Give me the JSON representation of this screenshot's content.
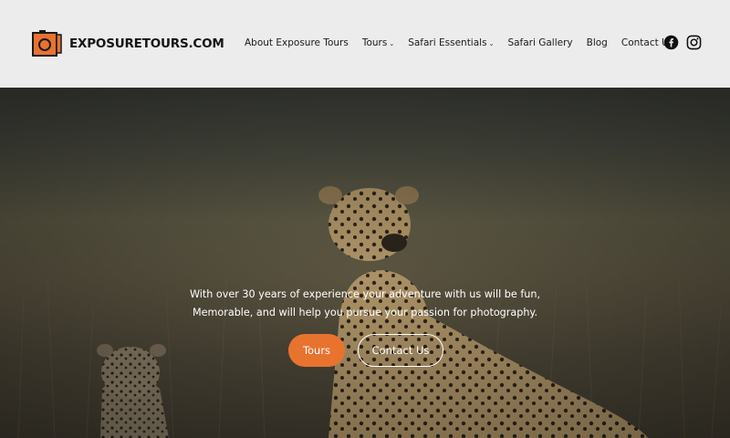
{
  "site": {
    "logo_text": "EXPOSURETOURS.COM",
    "accent_color": "#e8732f"
  },
  "nav": {
    "items": [
      {
        "label": "About Exposure Tours",
        "has_dropdown": false
      },
      {
        "label": "Tours",
        "has_dropdown": true
      },
      {
        "label": "Safari Essentials",
        "has_dropdown": true
      },
      {
        "label": "Safari Gallery",
        "has_dropdown": false
      },
      {
        "label": "Blog",
        "has_dropdown": false
      },
      {
        "label": "Contact Us",
        "has_dropdown": false
      }
    ],
    "social": [
      "facebook-icon",
      "instagram-icon"
    ]
  },
  "hero": {
    "line1": "With over 30 years of experience your adventure with us will be fun,",
    "line2": "Memorable, and will help you pursue your passion for photography.",
    "primary_button": "Tours",
    "secondary_button": "Contact Us"
  }
}
